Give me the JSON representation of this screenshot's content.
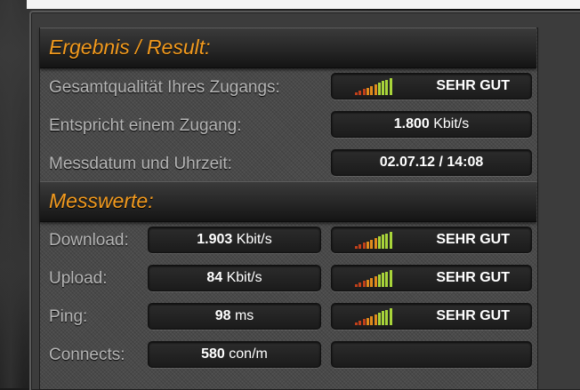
{
  "result_section": {
    "title": "Ergebnis / Result:",
    "rows": [
      {
        "label": "Gesamtqualität Ihres Zugangs:",
        "value": "SEHR GUT",
        "bars": 10
      },
      {
        "label": "Entspricht einem Zugang:",
        "value_num": "1.800",
        "value_unit": "Kbit/s"
      },
      {
        "label": "Messdatum und Uhrzeit:",
        "value": "02.07.12 / 14:08"
      }
    ]
  },
  "measurements_section": {
    "title": "Messwerte:",
    "rows": [
      {
        "label": "Download:",
        "value_num": "1.903",
        "value_unit": "Kbit/s",
        "rating": "SEHR GUT"
      },
      {
        "label": "Upload:",
        "value_num": "84",
        "value_unit": "Kbit/s",
        "rating": "SEHR GUT"
      },
      {
        "label": "Ping:",
        "value_num": "98",
        "value_unit": "ms",
        "rating": "SEHR GUT"
      },
      {
        "label": "Connects:",
        "value_num": "580",
        "value_unit": "con/m",
        "rating": ""
      }
    ]
  },
  "colors": {
    "heading": "#f29a1e",
    "bar_low": "#c0401a",
    "bar_mid": "#e08a1c",
    "bar_high": "#a8d43a"
  }
}
